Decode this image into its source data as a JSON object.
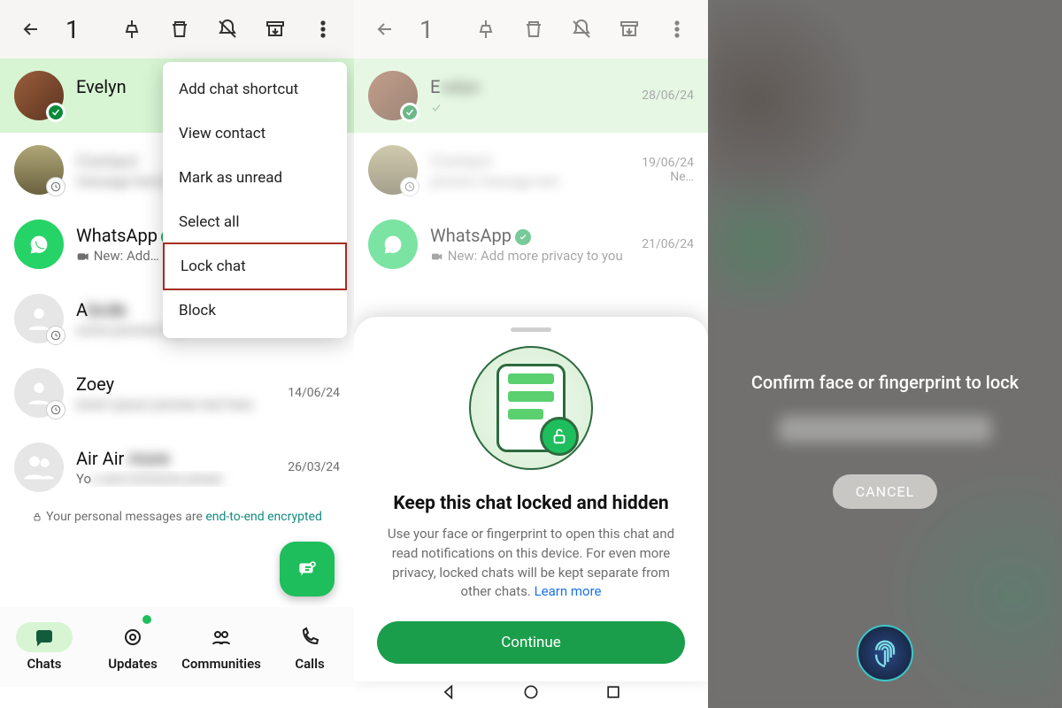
{
  "topbar": {
    "count": "1"
  },
  "menu": {
    "items": [
      "Add chat shortcut",
      "View contact",
      "Mark as unread",
      "Select all",
      "Lock chat",
      "Block"
    ],
    "highlight_index": 4
  },
  "panel1": {
    "chats": [
      {
        "name": "Evelyn",
        "preview": "",
        "date": ""
      },
      {
        "name": "Contact",
        "preview": "today",
        "date": ""
      },
      {
        "name": "WhatsApp",
        "verified": true,
        "preview": "New: Add…",
        "preview_icon": "video",
        "date": ""
      },
      {
        "name": "A",
        "preview": "",
        "date": ""
      },
      {
        "name": "Zoey",
        "preview": "",
        "date": "14/06/24"
      },
      {
        "name": "Air Air",
        "preview": "Yo",
        "date": "26/03/24"
      }
    ],
    "e2e_prefix": "Your personal messages are ",
    "e2e_link": "end-to-end encrypted",
    "tabs": [
      "Chats",
      "Updates",
      "Communities",
      "Calls"
    ]
  },
  "panel2": {
    "chats": [
      {
        "name": "E",
        "date": "28/06/24"
      },
      {
        "name": "",
        "date": "19/06/24",
        "meta2": "Ne…"
      },
      {
        "name": "WhatsApp",
        "verified": true,
        "preview": "New: Add more privacy to you",
        "date": "21/06/24"
      }
    ],
    "sheet": {
      "title": "Keep this chat locked and hidden",
      "desc_a": "Use your face or fingerprint to open this chat and read notifications on this device. For even more privacy, locked chats will be kept separate from other chats. ",
      "learn": "Learn more",
      "cta": "Continue"
    }
  },
  "panel3": {
    "title": "Confirm face or fingerprint to lock",
    "cancel": "CANCEL"
  }
}
